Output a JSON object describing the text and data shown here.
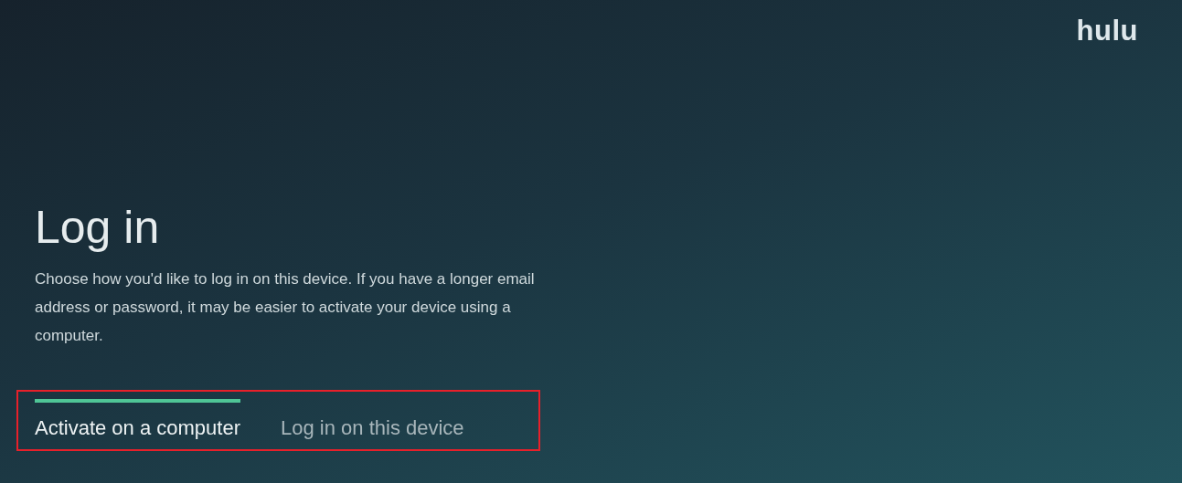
{
  "logo": {
    "text": "hulu"
  },
  "title": "Log in",
  "description": "Choose how you'd like to log in on this device. If you have a longer email address or password, it may be easier to activate your device using a computer.",
  "tabs": [
    {
      "label": "Activate on a computer",
      "selected": true
    },
    {
      "label": "Log in on this device",
      "selected": false
    }
  ],
  "highlight": {
    "on": true
  }
}
